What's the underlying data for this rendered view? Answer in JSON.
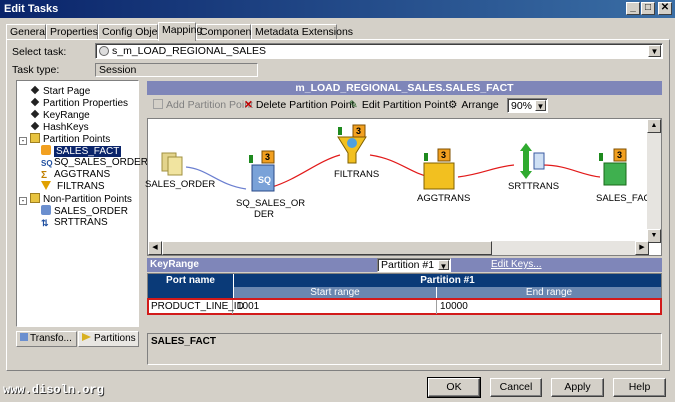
{
  "window": {
    "title": "Edit Tasks",
    "controls": [
      "_",
      "□",
      "✕"
    ]
  },
  "tabs": [
    {
      "label": "General"
    },
    {
      "label": "Properties"
    },
    {
      "label": "Config Object"
    },
    {
      "label": "Mapping",
      "active": true
    },
    {
      "label": "Components"
    },
    {
      "label": "Metadata Extensions"
    }
  ],
  "select_task": {
    "label": "Select task:",
    "value": "s_m_LOAD_REGIONAL_SALES"
  },
  "task_type": {
    "label": "Task type:",
    "value": "Session"
  },
  "tree": {
    "items": [
      {
        "label": "Start Page"
      },
      {
        "label": "Partition Properties"
      },
      {
        "label": "KeyRange"
      },
      {
        "label": "HashKeys"
      },
      {
        "label": "Partition Points"
      },
      {
        "label": "SALES_FACT",
        "selected": true
      },
      {
        "label": "SQ_SALES_ORDER"
      },
      {
        "label": "AGGTRANS"
      },
      {
        "label": "FILTRANS"
      },
      {
        "label": "Non-Partition Points"
      },
      {
        "label": "SALES_ORDER"
      },
      {
        "label": "SRTTRANS"
      }
    ]
  },
  "side_tabs": {
    "transformations": "Transfo...",
    "partitions": "Partitions"
  },
  "mapping_header": "m_LOAD_REGIONAL_SALES.SALES_FACT",
  "toolbar": {
    "add": "Add Partition Point",
    "delete": "Delete Partition Point",
    "edit": "Edit Partition Point",
    "arrange": "Arrange",
    "zoom": "90%"
  },
  "nodes": [
    {
      "label": "SALES_ORDER"
    },
    {
      "label": "SQ_SALES_OR\nDER",
      "badge": "3"
    },
    {
      "label": "FILTRANS",
      "badge": "3"
    },
    {
      "label": "AGGTRANS",
      "badge": "3"
    },
    {
      "label": "SRTTRANS"
    },
    {
      "label": "SALES_FACT",
      "badge": "3"
    }
  ],
  "keyrange": {
    "title": "KeyRange",
    "partition_select": "Partition #1",
    "edit_keys": "Edit Keys...",
    "headers": {
      "port": "Port name",
      "partition": "Partition #1",
      "start": "Start range",
      "end": "End range"
    },
    "rows": [
      {
        "port": "PRODUCT_LINE_ID",
        "start": "1001",
        "end": "10000"
      }
    ]
  },
  "status_label": "SALES_FACT",
  "buttons": {
    "ok": "OK",
    "cancel": "Cancel",
    "apply": "Apply",
    "help": "Help"
  },
  "watermark": "www.disoln.org",
  "colors": {
    "accent": "#0a246a",
    "header_blue": "#7f86b9",
    "link_red": "#e21a1a",
    "badge_orange": "#f2a020"
  }
}
